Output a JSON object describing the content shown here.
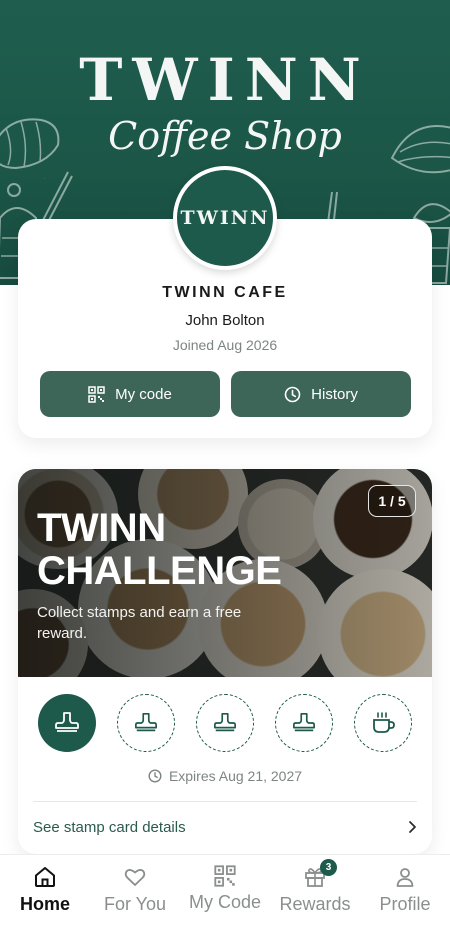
{
  "header": {
    "brand_title": "TWINN",
    "brand_subtitle": "Coffee Shop"
  },
  "profile": {
    "avatar_text": "TWINN",
    "cafe_name": "TWINN CAFE",
    "user_name": "John Bolton",
    "joined": "Joined Aug 2026",
    "my_code_label": "My code",
    "history_label": "History"
  },
  "challenge": {
    "page_indicator": "1 / 5",
    "title": "TWINN CHALLENGE",
    "description": "Collect stamps and earn a free reward.",
    "stamps_collected": 1,
    "stamps_total": 5,
    "expires": "Expires Aug 21, 2027",
    "details_link": "See stamp card details"
  },
  "nav": {
    "items": [
      {
        "label": "Home",
        "icon": "home-icon",
        "active": true
      },
      {
        "label": "For You",
        "icon": "heart-icon"
      },
      {
        "label": "My Code",
        "icon": "qr-code-icon"
      },
      {
        "label": "Rewards",
        "icon": "gift-icon",
        "badge": "3"
      },
      {
        "label": "Profile",
        "icon": "person-icon"
      }
    ]
  },
  "colors": {
    "brand_green": "#1d5a4b",
    "button_green": "#3d6659",
    "header_green": "#1f5e4f"
  }
}
